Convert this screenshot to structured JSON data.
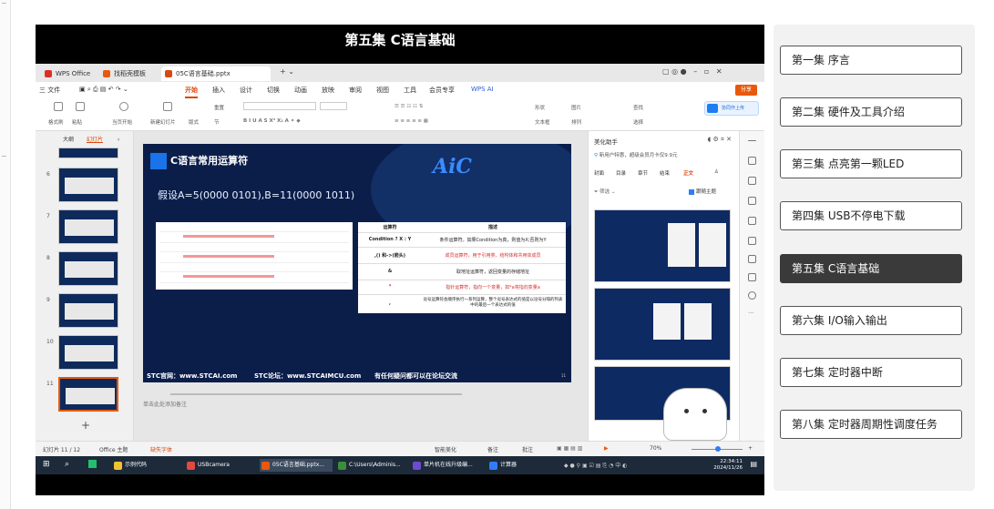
{
  "player": {
    "title": "第五集 C语言基础",
    "wps": {
      "tabs": [
        "WPS Office",
        "找稻壳模板",
        "05C语言基础.pptx"
      ],
      "menu": [
        "三 文件",
        "开始",
        "插入",
        "设计",
        "切换",
        "动画",
        "放映",
        "审阅",
        "视图",
        "工具",
        "会员专享",
        "WPS AI"
      ],
      "share_label": "分享",
      "ribbon_labels": [
        "格式刷",
        "粘贴",
        "当页开始",
        "新建幻灯片",
        "版式",
        "节",
        "重置",
        "形状",
        "图片",
        "查找",
        "文本框",
        "排列",
        "选择"
      ],
      "upload_label": "协同作上传",
      "slide_panel_tabs": [
        "大纲",
        "幻灯片"
      ],
      "thumb_numbers": [
        "6",
        "7",
        "8",
        "9",
        "10",
        "11"
      ],
      "slide": {
        "heading": "C语言常用运算符",
        "logo": "AiC",
        "assumption": "假设A=5(0000 0101),B=11(0000 1011)",
        "table_header": [
          "运算符",
          "描述"
        ],
        "table_rows": [
          [
            "Condition ? X : Y",
            "条件运算符。如果Condition为真，则值为X;否则为Y"
          ],
          [
            ",() 和->(箭头)",
            "成员运算符，用于引用类、结构体和共用体成员"
          ],
          [
            "&",
            "取地址运算符，返回变量的存储地址"
          ],
          [
            "*",
            "指针运算符，指向一个变量，如*a将指向变量a"
          ],
          [
            ",",
            "逗号运算符会顺序执行一系列运算，整个逗号表达式的值是以逗号分隔的列表中的最后一个表达式的值"
          ]
        ],
        "footer_site": "STC官网：www.STCAI.com",
        "footer_forum": "STC论坛：www.STCAIMCU.com",
        "footer_note": "有任何疑问都可以在论坛交流",
        "page": "11"
      },
      "note_placeholder": "单击此处添加备注",
      "beautify": {
        "title": "美化助手",
        "promo": "新用户特惠，超级会员月卡仅9.9元",
        "tabs": [
          "封面",
          "目录",
          "章节",
          "结束",
          "正文"
        ],
        "filter": "筛选",
        "keep_theme": "跟随主题"
      },
      "status": {
        "slide_count": "幻灯片 11 / 12",
        "theme": "Office 主题",
        "font_missing": "缺失字体",
        "smart_beautify": "智能美化",
        "notes": "备注",
        "comments": "批注",
        "zoom": "70%"
      },
      "taskbar": {
        "items": [
          "示例代码",
          "USBcamera",
          "05C语言基础.pptx...",
          "C:\\Users\\Adminis...",
          "单片机在线升级编...",
          "计算器"
        ],
        "time": "22:34:11",
        "date": "2024/11/26"
      }
    }
  },
  "episodes": [
    {
      "label": "第一集 序言",
      "active": false
    },
    {
      "label": "第二集 硬件及工具介绍",
      "active": false
    },
    {
      "label": "第三集 点亮第一颗LED",
      "active": false
    },
    {
      "label": "第四集 USB不停电下载",
      "active": false
    },
    {
      "label": "第五集 C语言基础",
      "active": true
    },
    {
      "label": "第六集 I/O输入输出",
      "active": false
    },
    {
      "label": "第七集 定时器中断",
      "active": false
    },
    {
      "label": "第八集 定时器周期性调度任务",
      "active": false
    }
  ]
}
